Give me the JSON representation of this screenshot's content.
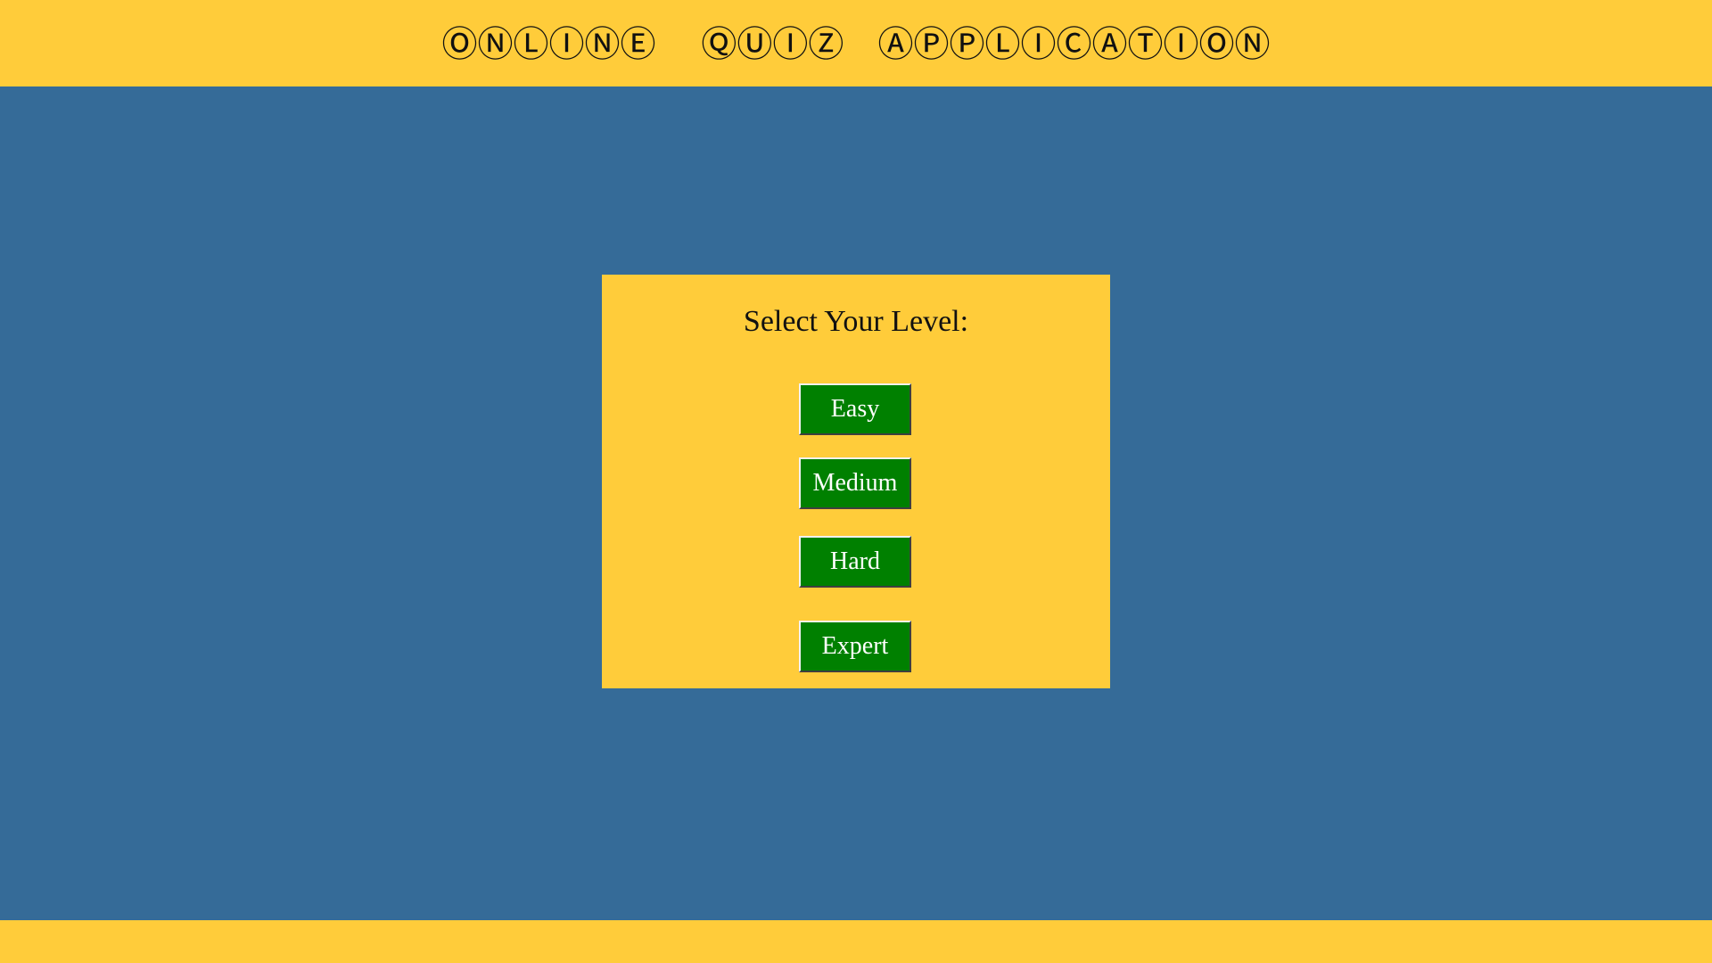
{
  "app": {
    "title": "ⓄⓃⓁⒾⓃⒺ    ⓆⓊⒾⓏ   ⒶⓅⓅⓁⒾⒸⒶⓉⒾⓄⓃ"
  },
  "level_panel": {
    "heading": "Select Your Level:",
    "buttons": [
      {
        "label": "Easy"
      },
      {
        "label": "Medium"
      },
      {
        "label": "Hard"
      },
      {
        "label": "Expert"
      }
    ]
  },
  "colors": {
    "background": "#356b98",
    "accent": "#ffcc3a",
    "button": "#008000",
    "button_text": "#ffffff",
    "text": "#111111"
  }
}
